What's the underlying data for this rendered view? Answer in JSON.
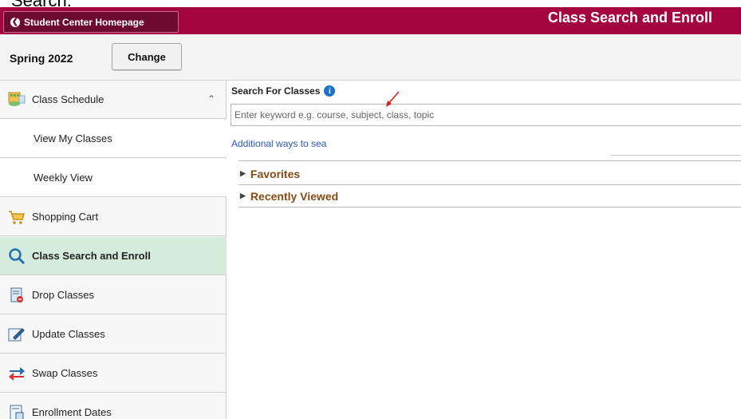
{
  "caption": {
    "clipped_text": "Search:"
  },
  "header": {
    "home_button": "Student Center Homepage",
    "title": "Class Search and Enroll",
    "bg_color": "#a5053e"
  },
  "term": {
    "label": "Spring 2022",
    "change_button": "Change"
  },
  "sidebar": {
    "items": [
      {
        "label": "Class Schedule",
        "icon": "class-schedule-icon",
        "expanded": true
      },
      {
        "label": "View My Classes",
        "sub": true
      },
      {
        "label": "Weekly View",
        "sub": true
      },
      {
        "label": "Shopping Cart",
        "icon": "shopping-cart-icon"
      },
      {
        "label": "Class Search and Enroll",
        "icon": "magnifier-icon",
        "active": true
      },
      {
        "label": "Drop Classes",
        "icon": "drop-classes-icon"
      },
      {
        "label": "Update Classes",
        "icon": "update-classes-icon"
      },
      {
        "label": "Swap Classes",
        "icon": "swap-arrows-icon"
      },
      {
        "label": "Enrollment Dates",
        "icon": "enrollment-dates-icon"
      }
    ],
    "active_color": "#d5ecdc"
  },
  "main": {
    "search_label": "Search For Classes",
    "search_placeholder": "Enter keyword e.g. course, subject, class, topic",
    "additional_link": "Additional ways to sea",
    "sections": [
      {
        "label": "Favorites"
      },
      {
        "label": "Recently Viewed"
      }
    ]
  }
}
